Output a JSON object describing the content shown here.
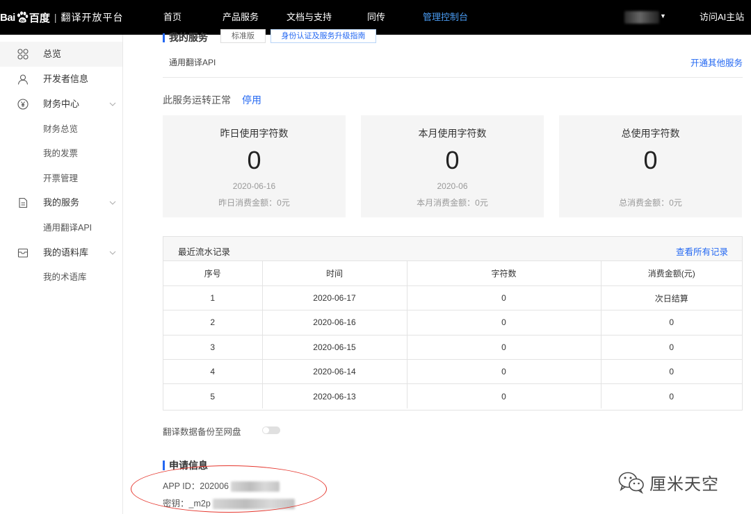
{
  "brand": {
    "logo_bai": "Bai",
    "logo_baidu": "百度",
    "separator": "|",
    "platform": "翻译开放平台"
  },
  "nav": {
    "items": [
      {
        "label": "首页",
        "active": false
      },
      {
        "label": "产品服务",
        "active": false
      },
      {
        "label": "文档与支持",
        "active": false
      },
      {
        "label": "同传",
        "active": false
      },
      {
        "label": "管理控制台",
        "active": true
      }
    ],
    "user_caret": "▼",
    "visit_ai": "访问AI主站"
  },
  "sidebar": {
    "items": [
      {
        "label": "总览",
        "icon": "grid-icon",
        "active": true
      },
      {
        "label": "开发者信息",
        "icon": "user-icon"
      },
      {
        "label": "财务中心",
        "icon": "yen-icon",
        "expandable": true,
        "children": [
          "财务总览",
          "我的发票",
          "开票管理"
        ]
      },
      {
        "label": "我的服务",
        "icon": "document-icon",
        "expandable": true,
        "children": [
          "通用翻译API"
        ]
      },
      {
        "label": "我的语料库",
        "icon": "box-icon",
        "expandable": true,
        "children": [
          "我的术语库"
        ]
      }
    ]
  },
  "service": {
    "section_title": "我的服务",
    "badge": "标准版",
    "upgrade_link": "身份认证及服务升级指南",
    "tab": "通用翻译API",
    "other_services_link": "开通其他服务",
    "status_text": "此服务运转正常",
    "disable_link": "停用"
  },
  "stats": [
    {
      "title": "昨日使用字符数",
      "value": "0",
      "date": "2020-06-16",
      "amount": "昨日消费金额：0元"
    },
    {
      "title": "本月使用字符数",
      "value": "0",
      "date": "2020-06",
      "amount": "本月消费金额：0元"
    },
    {
      "title": "总使用字符数",
      "value": "0",
      "date": "",
      "amount": "总消费金额：0元"
    }
  ],
  "records": {
    "title": "最近流水记录",
    "view_all": "查看所有记录",
    "columns": [
      "序号",
      "时间",
      "字符数",
      "消费金额(元)"
    ],
    "rows": [
      [
        "1",
        "2020-06-17",
        "0",
        "次日结算"
      ],
      [
        "2",
        "2020-06-16",
        "0",
        "0"
      ],
      [
        "3",
        "2020-06-15",
        "0",
        "0"
      ],
      [
        "4",
        "2020-06-14",
        "0",
        "0"
      ],
      [
        "5",
        "2020-06-13",
        "0",
        "0"
      ]
    ]
  },
  "backup": {
    "label": "翻译数据备份至网盘",
    "enabled": false
  },
  "application": {
    "title": "申请信息",
    "app_id_label": "APP ID：",
    "app_id_value": "202006",
    "secret_label": "密钥：",
    "secret_value": "_m2p"
  },
  "watermark": {
    "text": "厘米天空",
    "icon": "wechat-icon"
  },
  "colors": {
    "accent": "#2468f2",
    "nav_active": "#4a9cf3",
    "annotation": "#e5352c"
  }
}
